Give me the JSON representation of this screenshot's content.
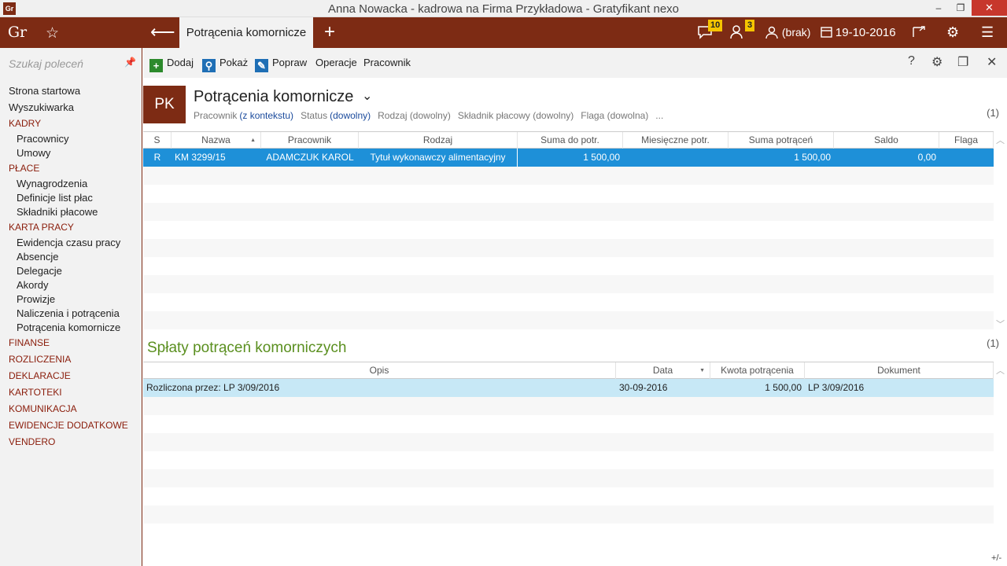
{
  "window": {
    "title": "Anna Nowacka - kadrowa na Firma Przykładowa - Gratyfikant nexo",
    "app_icon": "Gr",
    "buttons": {
      "minimize": "–",
      "restore": "❐",
      "close": "✕"
    }
  },
  "appbar": {
    "logo": "Gr",
    "tab_label": "Potrącenia komornicze",
    "messages_count": "10",
    "tasks_count": "3",
    "user_label": "(brak)",
    "date": "19-10-2016",
    "accent": "#7d2b14"
  },
  "sidebar": {
    "search_placeholder": "Szukaj poleceń",
    "items": [
      {
        "label": "Strona startowa",
        "kind": "top"
      },
      {
        "label": "Wyszukiwarka",
        "kind": "top"
      },
      {
        "label": "KADRY",
        "kind": "cat"
      },
      {
        "label": "Pracownicy",
        "kind": "sub"
      },
      {
        "label": "Umowy",
        "kind": "sub"
      },
      {
        "label": "PŁACE",
        "kind": "cat"
      },
      {
        "label": "Wynagrodzenia",
        "kind": "sub"
      },
      {
        "label": "Definicje list płac",
        "kind": "sub"
      },
      {
        "label": "Składniki płacowe",
        "kind": "sub"
      },
      {
        "label": "KARTA PRACY",
        "kind": "cat"
      },
      {
        "label": "Ewidencja czasu pracy",
        "kind": "sub"
      },
      {
        "label": "Absencje",
        "kind": "sub"
      },
      {
        "label": "Delegacje",
        "kind": "sub"
      },
      {
        "label": "Akordy",
        "kind": "sub"
      },
      {
        "label": "Prowizje",
        "kind": "sub"
      },
      {
        "label": "Naliczenia i potrącenia",
        "kind": "sub"
      },
      {
        "label": "Potrącenia komornicze",
        "kind": "sub"
      },
      {
        "label": "FINANSE",
        "kind": "cat"
      },
      {
        "label": "ROZLICZENIA",
        "kind": "cat"
      },
      {
        "label": "DEKLARACJE",
        "kind": "cat"
      },
      {
        "label": "KARTOTEKI",
        "kind": "cat"
      },
      {
        "label": "KOMUNIKACJA",
        "kind": "cat"
      },
      {
        "label": "EWIDENCJE DODATKOWE",
        "kind": "cat"
      },
      {
        "label": "VENDERO",
        "kind": "cat"
      }
    ]
  },
  "toolbar": {
    "add": "Dodaj",
    "show": "Pokaż",
    "edit": "Popraw",
    "operations": "Operacje",
    "employee": "Pracownik",
    "help": "?"
  },
  "header": {
    "badge": "PK",
    "title": "Potrącenia komornicze",
    "filters": [
      {
        "label": "Pracownik",
        "value": "(z kontekstu)"
      },
      {
        "label": "Status",
        "value": "(dowolny)"
      },
      {
        "label": "Rodzaj (dowolny)",
        "value": ""
      },
      {
        "label": "Składnik płacowy (dowolny)",
        "value": ""
      },
      {
        "label": "Flaga (dowolna)",
        "value": ""
      },
      {
        "label": "...",
        "value": ""
      }
    ],
    "count": "(1)"
  },
  "main_table": {
    "columns": [
      "S",
      "Nazwa",
      "Pracownik",
      "Rodzaj",
      "Suma do potr.",
      "Miesięczne potr.",
      "Suma potrąceń",
      "Saldo",
      "Flaga"
    ],
    "rows": [
      {
        "s": "R",
        "nazwa": "KM 3299/15",
        "pracownik": "ADAMCZUK KAROL",
        "rodzaj": "Tytuł wykonawczy alimentacyjny",
        "suma_do_potr": "1 500,00",
        "miesieczne": "",
        "suma_potracen": "1 500,00",
        "saldo": "0,00",
        "flaga": ""
      }
    ]
  },
  "sub_section": {
    "title": "Spłaty potrąceń komorniczych",
    "count": "(1)",
    "columns": [
      "Opis",
      "Data",
      "Kwota potrącenia",
      "Dokument"
    ],
    "rows": [
      {
        "opis": "Rozliczona przez: LP 3/09/2016",
        "data": "30-09-2016",
        "kwota": "1 500,00",
        "dokument": "LP 3/09/2016"
      }
    ]
  },
  "corner_label": "+/-"
}
